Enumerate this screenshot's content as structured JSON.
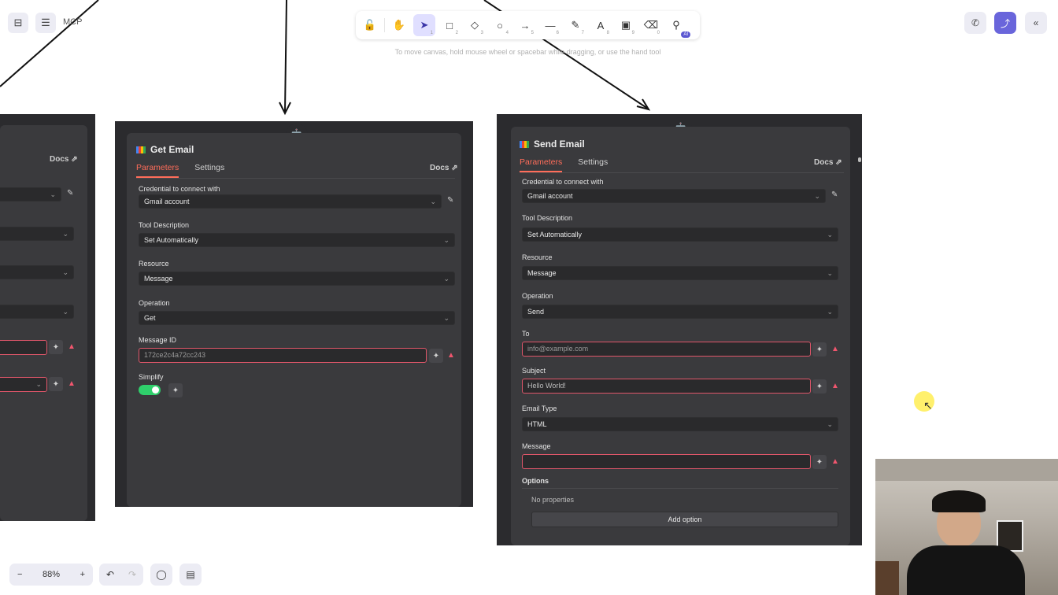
{
  "app": {
    "title": "MCP"
  },
  "toolbar": {
    "tools": [
      {
        "name": "lock-icon",
        "glyph": "🔓",
        "key": ""
      },
      {
        "name": "hand-icon",
        "glyph": "✋",
        "key": ""
      },
      {
        "name": "selection-icon",
        "glyph": "➤",
        "key": "1",
        "active": true
      },
      {
        "name": "rectangle-icon",
        "glyph": "□",
        "key": "2"
      },
      {
        "name": "diamond-icon",
        "glyph": "◇",
        "key": "3"
      },
      {
        "name": "ellipse-icon",
        "glyph": "○",
        "key": "4"
      },
      {
        "name": "arrow-icon",
        "glyph": "→",
        "key": "5"
      },
      {
        "name": "line-icon",
        "glyph": "—",
        "key": "6"
      },
      {
        "name": "pencil-icon",
        "glyph": "✎",
        "key": "7"
      },
      {
        "name": "text-icon",
        "glyph": "A",
        "key": "8"
      },
      {
        "name": "image-icon",
        "glyph": "▣",
        "key": "9"
      },
      {
        "name": "eraser-icon",
        "glyph": "⌫",
        "key": "0"
      },
      {
        "name": "more-tools-icon",
        "glyph": "⚲",
        "key": ""
      }
    ],
    "badge": "AI",
    "hint": "To move canvas, hold mouse wheel or spacebar while dragging, or use the hand tool"
  },
  "zoom": {
    "minus": "−",
    "value": "88%",
    "plus": "+"
  },
  "left_panel": {
    "docs": "Docs ⇗"
  },
  "get_email": {
    "title": "Get Email",
    "tabs": [
      "Parameters",
      "Settings"
    ],
    "docs": "Docs ⇗",
    "credential_label": "Credential to connect with",
    "credential_value": "Gmail account",
    "tool_desc_label": "Tool Description",
    "tool_desc_value": "Set Automatically",
    "resource_label": "Resource",
    "resource_value": "Message",
    "operation_label": "Operation",
    "operation_value": "Get",
    "message_id_label": "Message ID",
    "message_id_value": "172ce2c4a72cc243",
    "simplify_label": "Simplify"
  },
  "send_email": {
    "title": "Send Email",
    "tabs": [
      "Parameters",
      "Settings"
    ],
    "docs": "Docs ⇗",
    "credential_label": "Credential to connect with",
    "credential_value": "Gmail account",
    "tool_desc_label": "Tool Description",
    "tool_desc_value": "Set Automatically",
    "resource_label": "Resource",
    "resource_value": "Message",
    "operation_label": "Operation",
    "operation_value": "Send",
    "to_label": "To",
    "to_placeholder": "info@example.com",
    "subject_label": "Subject",
    "subject_value": "Hello World!",
    "email_type_label": "Email Type",
    "email_type_value": "HTML",
    "message_label": "Message",
    "options_label": "Options",
    "no_properties": "No properties",
    "add_option": "Add option"
  },
  "colors": {
    "accent": "#ff6d5a",
    "share": "#6965db",
    "toggle": "#2fcf6b",
    "warn": "#f0566e"
  }
}
